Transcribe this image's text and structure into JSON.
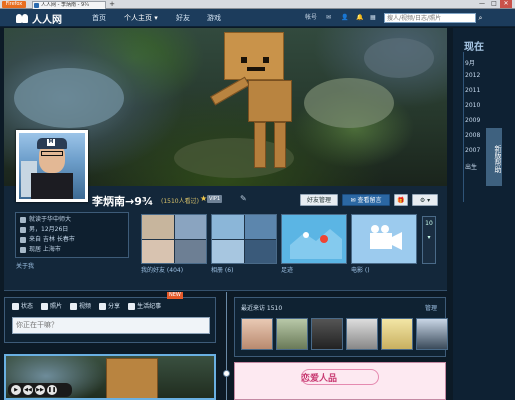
{
  "browser": {
    "menu_button": "Firefox",
    "tab_title": "人人网 - 李炳南 - 9¾",
    "new_tab": "+",
    "win_min": "—",
    "win_max": "□",
    "win_close": "✕"
  },
  "topnav": {
    "logo": "人人网",
    "items": [
      "首页",
      "个人主页 ▾",
      "好友",
      "游戏"
    ],
    "right_links": [
      "帐号"
    ],
    "search_placeholder": "搜人/视频/日志/照片",
    "search_icon": "search-icon"
  },
  "timeline_nav": {
    "heading": "现在",
    "entries": [
      "9月",
      "2012",
      "2011",
      "2010",
      "2009",
      "2008",
      "2007",
      "出生"
    ],
    "side_tab": "新版帮助"
  },
  "profile": {
    "name": "李炳南→9¾",
    "visits": "(1510人看过)",
    "vip_badge": "VIP1",
    "buttons": {
      "friends": "好友管理",
      "message": "✉ 查看留言",
      "gift": "🎁",
      "settings": "⚙ ▾"
    },
    "info": [
      "就读于华中师大",
      "男，12月26日",
      "来自 吉林 长春市",
      "现居 上海市"
    ],
    "about_link": "关于我",
    "thumbs": [
      {
        "label": "我的好友 (404)"
      },
      {
        "label": "相册 (6)"
      },
      {
        "label": "足迹"
      },
      {
        "label": "电影 ()"
      }
    ],
    "more_count": "10"
  },
  "status": {
    "tabs": [
      "状态",
      "照片",
      "视频",
      "分享",
      "生活纪事"
    ],
    "new_badge": "NEW",
    "input_placeholder": "你正在干嘛？"
  },
  "visitors": {
    "title": "最近来访 1510",
    "manage": "管理"
  },
  "ad": {
    "text": "恋爱人品"
  },
  "colors": {
    "nav_bg": "#1c3c5c",
    "accent": "#2b67a3",
    "page_bg": "#0c1a26"
  }
}
